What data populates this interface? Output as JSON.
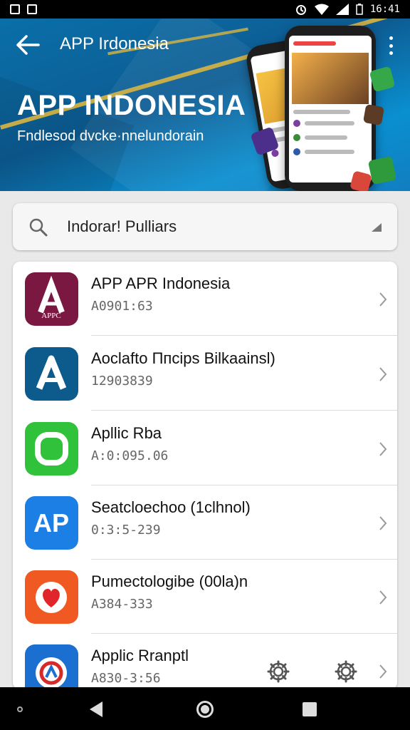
{
  "status_bar": {
    "time": "16:41"
  },
  "header": {
    "title": "APP Irdonesia",
    "banner_headline": "APP INDONESIA",
    "banner_subtitle": "Fndlesod dvcke·nnelundorain"
  },
  "search": {
    "value": "Indorar! Pulliars"
  },
  "apps": [
    {
      "name": "APP APR Indonesia",
      "sub": "A0901:63",
      "icon_text": "APPC",
      "icon_color": "#7b1842"
    },
    {
      "name": "Aoclafto Ппcips Bilkaainsl)",
      "sub": "12903839",
      "icon_text": "",
      "icon_color": "#0d5a8c"
    },
    {
      "name": "Apllic Rbа",
      "sub": "A:0:095.06",
      "icon_text": "",
      "icon_color": "#2fc23a"
    },
    {
      "name": "Seatcloechoo (1clhnol)",
      "sub": "0:3:5-239",
      "icon_text": "AP",
      "icon_color": "#1c7fe6"
    },
    {
      "name": "Pumectologibe (00la)n",
      "sub": "A384-333",
      "icon_text": "",
      "icon_color": "#f05a22"
    },
    {
      "name": "Applic Rranptl",
      "sub": "A830-3:56",
      "icon_text": "",
      "icon_color": "#1a6fd0"
    }
  ],
  "colors": {
    "banner": "#0d5c93",
    "accent_stripe": "#d8b542"
  }
}
